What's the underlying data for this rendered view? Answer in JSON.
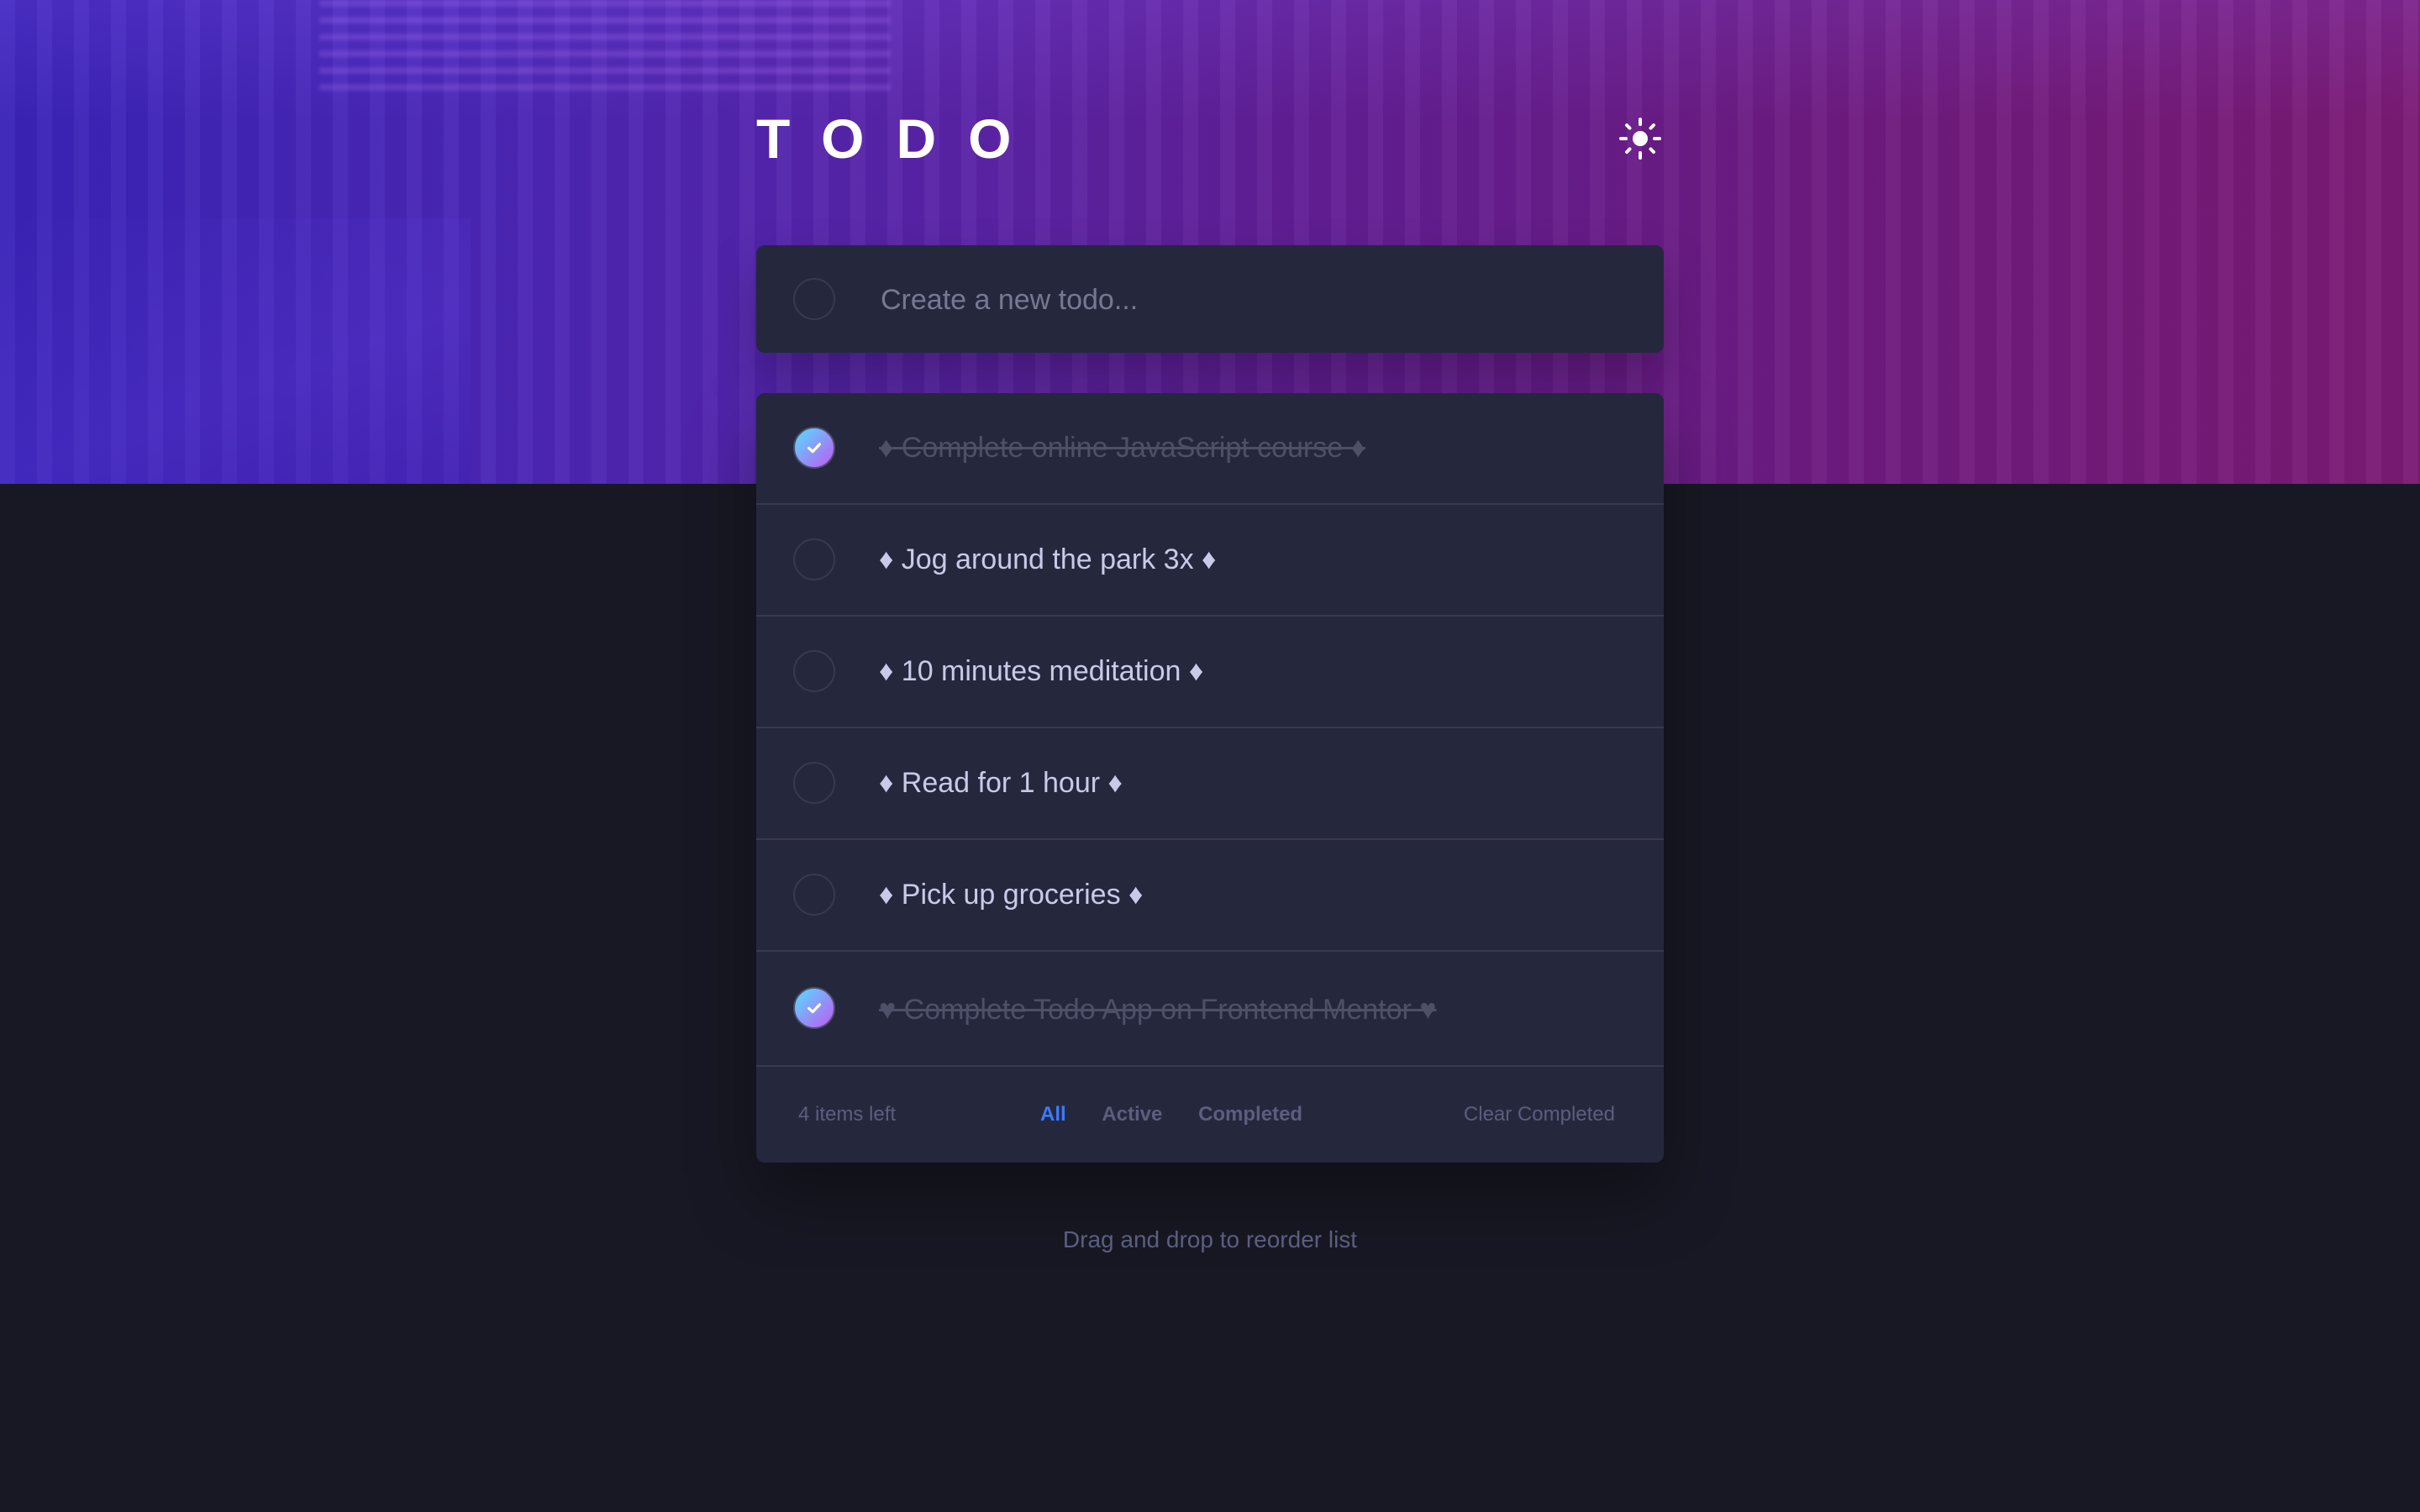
{
  "app": {
    "title": "TODO",
    "theme_toggle_icon": "sun-icon"
  },
  "new_todo": {
    "placeholder": "Create a new todo...",
    "value": ""
  },
  "todos": [
    {
      "text": "♦ Complete online JavaScript course ♦",
      "completed": true
    },
    {
      "text": "♦ Jog around the park 3x ♦",
      "completed": false
    },
    {
      "text": "♦ 10 minutes meditation ♦",
      "completed": false
    },
    {
      "text": "♦ Read for 1 hour ♦",
      "completed": false
    },
    {
      "text": "♦ Pick up groceries ♦",
      "completed": false
    },
    {
      "text": "♥ Complete Todo App on Frontend Mentor ♥",
      "completed": true
    }
  ],
  "footer": {
    "items_left": "4 items left",
    "filters": [
      {
        "label": "All",
        "active": true
      },
      {
        "label": "Active",
        "active": false
      },
      {
        "label": "Completed",
        "active": false
      }
    ],
    "clear_completed": "Clear Completed"
  },
  "hint": "Drag and drop to reorder list",
  "colors": {
    "background": "#171823",
    "card": "#25273d",
    "accent": "#3a7cfd",
    "check_gradient_start": "#55ddff",
    "check_gradient_end": "#c058f3",
    "header_gradient_start": "#3a23b8",
    "header_gradient_end": "#7b1a74"
  }
}
